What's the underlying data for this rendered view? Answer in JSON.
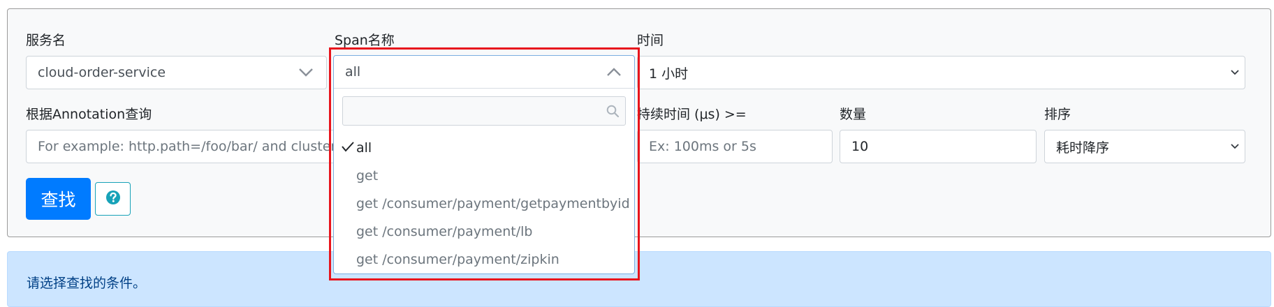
{
  "form": {
    "service_label": "服务名",
    "service_value": "cloud-order-service",
    "span_label": "Span名称",
    "span_value": "all",
    "time_label": "时间",
    "time_value": "1 小时",
    "annotation_label": "根据Annotation查询",
    "annotation_placeholder": "For example: http.path=/foo/bar/ and cluster=fo",
    "duration_label": "持续时间 (μs) >=",
    "duration_placeholder": "Ex: 100ms or 5s",
    "count_label": "数量",
    "count_value": "10",
    "sort_label": "排序",
    "sort_value": "耗时降序",
    "search_button": "查找"
  },
  "dropdown": {
    "search_value": "",
    "items": [
      {
        "label": "all",
        "selected": true
      },
      {
        "label": "get",
        "selected": false
      },
      {
        "label": "get /consumer/payment/getpaymentbyid",
        "selected": false
      },
      {
        "label": "get /consumer/payment/lb",
        "selected": false
      },
      {
        "label": "get /consumer/payment/zipkin",
        "selected": false
      }
    ]
  },
  "alert": {
    "message": "请选择查找的条件。"
  },
  "colors": {
    "primary": "#007bff",
    "info": "#17a2b8",
    "alert_bg": "#cce5ff",
    "highlight": "#e8141c"
  },
  "icons": [
    "chevron-down-icon",
    "chevron-up-icon",
    "search-icon",
    "check-icon",
    "question-circle-icon"
  ]
}
